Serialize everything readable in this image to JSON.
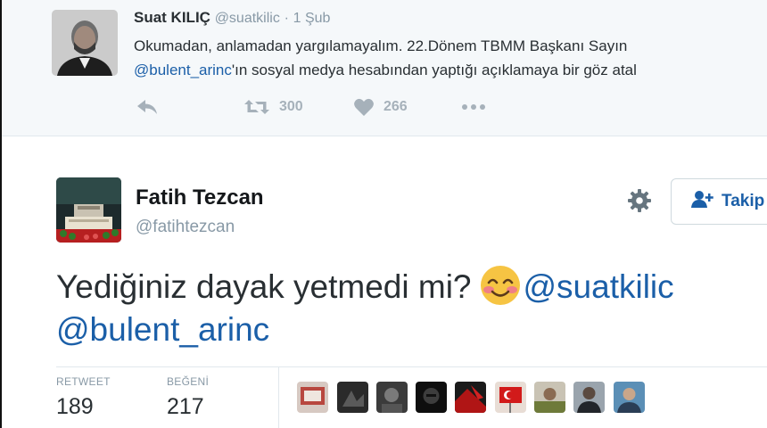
{
  "reply_tweet": {
    "author_name": "Suat KILIÇ",
    "author_handle": "@suatkilic",
    "separator": "·",
    "timestamp": "1 Şub",
    "text_line1": "Okumadan, anlamadan yargılamayalım. 22.Dönem TBMM Başkanı Sayın",
    "text_mention": "@bulent_arinc",
    "text_line2_rest": "'ın sosyal medya hesabından yaptığı açıklamaya bir göz atal",
    "retweet_count": "300",
    "like_count": "266",
    "icons": [
      "reply-icon",
      "retweet-icon",
      "heart-icon",
      "more-icon"
    ]
  },
  "main_tweet": {
    "author_name": "Fatih Tezcan",
    "author_handle": "@fatihtezcan",
    "follow_label": "Takip et",
    "text": "Yediğiniz dayak yetmedi mi?",
    "mention1": "@suatkilic",
    "mention2": "@bulent_arinc",
    "emoji": "smiling-face-with-smiling-eyes",
    "retweet_label": "RETWEET",
    "retweet_value": "189",
    "like_label": "BEĞENİ",
    "like_value": "217",
    "liker_avatar_count": 9
  },
  "colors": {
    "link": "#1b5fa8",
    "muted": "#8899a6",
    "action_gray": "#a6b1ba",
    "reply_bg": "#f5f8fa"
  }
}
